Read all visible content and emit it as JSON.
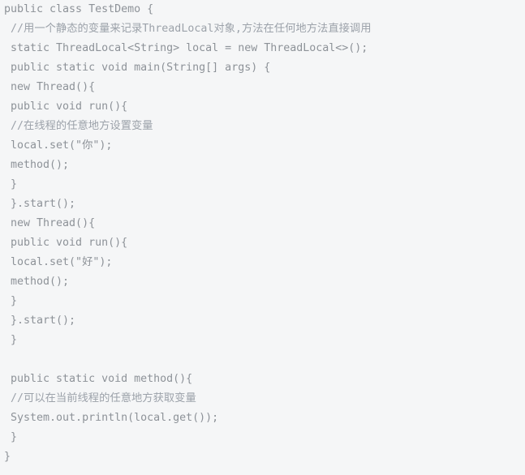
{
  "editor": {
    "kind": "code-snippet",
    "language": "java",
    "background_color": "#f5f6f7",
    "code_color": "#8d9298",
    "comment_color": "#9ca2aa",
    "line_height_px": 24,
    "font_size_px": 13,
    "total_lines": 24,
    "lines": [
      {
        "text": "public class TestDemo {",
        "type": "code"
      },
      {
        "text": " //用一个静态的变量来记录ThreadLocal对象,方法在任何地方法直接调用",
        "type": "comment"
      },
      {
        "text": " static ThreadLocal<String> local = new ThreadLocal<>();",
        "type": "code"
      },
      {
        "text": " public static void main(String[] args) {",
        "type": "code"
      },
      {
        "text": " new Thread(){",
        "type": "code"
      },
      {
        "text": " public void run(){",
        "type": "code"
      },
      {
        "text": " //在线程的任意地方设置变量",
        "type": "comment"
      },
      {
        "text": " local.set(\"你\");",
        "type": "code"
      },
      {
        "text": " method();",
        "type": "code"
      },
      {
        "text": " }",
        "type": "code"
      },
      {
        "text": " }.start();",
        "type": "code"
      },
      {
        "text": " new Thread(){",
        "type": "code"
      },
      {
        "text": " public void run(){",
        "type": "code"
      },
      {
        "text": " local.set(\"好\");",
        "type": "code"
      },
      {
        "text": " method();",
        "type": "code"
      },
      {
        "text": " }",
        "type": "code"
      },
      {
        "text": " }.start();",
        "type": "code"
      },
      {
        "text": " }",
        "type": "code"
      },
      {
        "text": "",
        "type": "blank"
      },
      {
        "text": " public static void method(){",
        "type": "code"
      },
      {
        "text": " //可以在当前线程的任意地方获取变量",
        "type": "comment"
      },
      {
        "text": " System.out.println(local.get());",
        "type": "code"
      },
      {
        "text": " }",
        "type": "code"
      },
      {
        "text": "}",
        "type": "code"
      }
    ]
  }
}
